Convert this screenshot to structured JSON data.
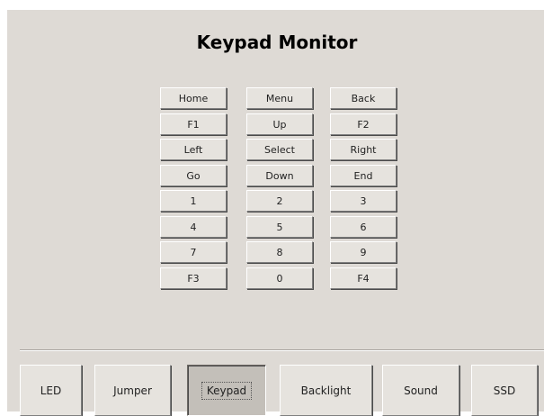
{
  "page": {
    "title": "Keypad Monitor"
  },
  "keypad": {
    "rows": [
      [
        "Home",
        "Menu",
        "Back"
      ],
      [
        "F1",
        "Up",
        "F2"
      ],
      [
        "Left",
        "Select",
        "Right"
      ],
      [
        "Go",
        "Down",
        "End"
      ],
      [
        "1",
        "2",
        "3"
      ],
      [
        "4",
        "5",
        "6"
      ],
      [
        "7",
        "8",
        "9"
      ],
      [
        "F3",
        "0",
        "F4"
      ]
    ]
  },
  "nav": {
    "tabs": [
      {
        "label": "LED",
        "active": false
      },
      {
        "label": "Jumper",
        "active": false
      },
      {
        "label": "Keypad",
        "active": true
      },
      {
        "label": "Backlight",
        "active": false
      },
      {
        "label": "Sound",
        "active": false
      },
      {
        "label": "SSD",
        "active": false
      }
    ]
  }
}
